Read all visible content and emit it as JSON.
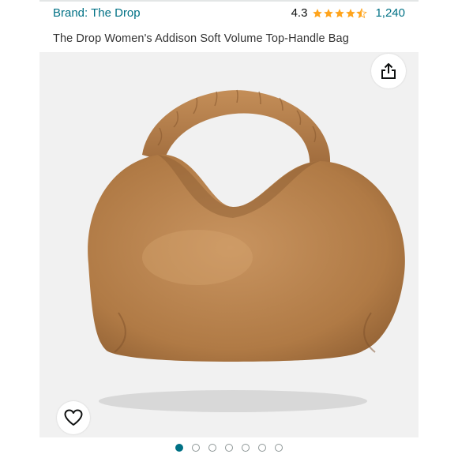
{
  "header": {
    "brand_link": "Brand: The Drop",
    "rating_value": "4.3",
    "rating_stars": 4.3,
    "rating_count": "1,240"
  },
  "product": {
    "title": "The Drop Women's Addison Soft Volume Top-Handle Bag",
    "image_subject": "tan leather hobo top-handle bag"
  },
  "icons": {
    "share": "share-icon",
    "wishlist": "heart-icon",
    "star": "star-icon"
  },
  "carousel": {
    "total_images": 7,
    "active_index": 0
  },
  "colors": {
    "link": "#007185",
    "star": "#FFA41C",
    "bag": "#b9854f"
  }
}
